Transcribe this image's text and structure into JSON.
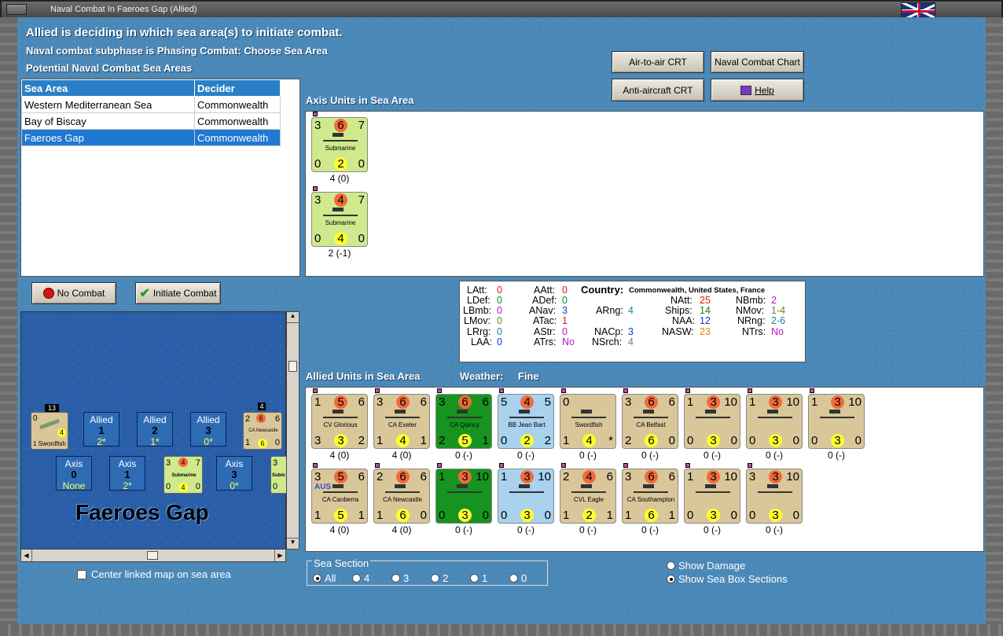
{
  "window": {
    "title": "Naval Combat In Faeroes Gap (Allied)"
  },
  "header": {
    "line1": "Allied is deciding in which sea area(s) to initiate combat.",
    "line2": "Naval combat subphase is Phasing Combat: Choose Sea Area",
    "line3": "Potential Naval Combat Sea Areas"
  },
  "buttons": {
    "air_to_air": "Air-to-air CRT",
    "naval_chart": "Naval Combat Chart",
    "anti_aircraft": "Anti-aircraft CRT",
    "help": "Help",
    "no_combat": "No Combat",
    "initiate_combat": "Initiate Combat"
  },
  "sea_table": {
    "headers": [
      "Sea Area",
      "Decider"
    ],
    "rows": [
      {
        "area": "Western Mediterranean Sea",
        "decider": "Commonwealth"
      },
      {
        "area": "Bay of Biscay",
        "decider": "Commonwealth"
      },
      {
        "area": "Faeroes Gap",
        "decider": "Commonwealth"
      }
    ]
  },
  "axis": {
    "label": "Axis Units in Sea Area",
    "units": [
      {
        "tl": "3",
        "tc": "6",
        "tr": "7",
        "name": "Submarine",
        "bl": "0",
        "bc": "2",
        "br": "0",
        "caption": "4 (0)"
      },
      {
        "tl": "3",
        "tc": "4",
        "tr": "7",
        "name": "Submarine",
        "bl": "0",
        "bc": "4",
        "br": "0",
        "caption": "2 (-1)"
      }
    ]
  },
  "stats": {
    "country_label": "Country:",
    "country": "Commonwealth, United States, France",
    "LAtt": "0",
    "LDef": "0",
    "LBmb": "0",
    "LMov": "0",
    "LRrg": "0",
    "LAA": "0",
    "AAtt": "0",
    "ADef": "0",
    "ANav": "3",
    "ATac": "1",
    "AStr": "0",
    "ATrs": "No",
    "ARng": "4",
    "NACp": "3",
    "NSrch": "4",
    "NAtt": "25",
    "Ships": "14",
    "NAA": "12",
    "NASW": "23",
    "NBmb": "2",
    "NMov": "1-4",
    "NRng": "2-6",
    "NTrs": "No"
  },
  "allied": {
    "label": "Allied Units in Sea Area",
    "weather_label": "Weather:",
    "weather": "Fine",
    "row1": [
      {
        "tl": "1",
        "tc": "5",
        "tr": "6",
        "name": "CV Glorious",
        "bl": "3",
        "bc": "3",
        "br": "2",
        "caption": "4 (0)",
        "style": "tan"
      },
      {
        "tl": "3",
        "tc": "6",
        "tr": "6",
        "name": "CA Exeter",
        "bl": "1",
        "bc": "4",
        "br": "1",
        "caption": "4 (0)",
        "style": "tan"
      },
      {
        "tl": "3",
        "tc": "6",
        "tr": "6",
        "name": "CA Quincy",
        "bl": "2",
        "bc": "5",
        "br": "1",
        "caption": "0 (-)",
        "style": "green"
      },
      {
        "tl": "5",
        "tc": "4",
        "tr": "5",
        "name": "BB Jean Bart",
        "bl": "0",
        "bc": "2",
        "br": "2",
        "caption": "0 (-)",
        "style": "blue"
      },
      {
        "tl": "0",
        "tc": "",
        "tr": "",
        "name": "Swordfish",
        "bl": "1",
        "bc": "4",
        "br": "*",
        "caption": "0 (-)",
        "style": "tan"
      },
      {
        "tl": "3",
        "tc": "6",
        "tr": "6",
        "name": "CA Belfast",
        "bl": "2",
        "bc": "6",
        "br": "0",
        "caption": "0 (-)",
        "style": "tan"
      },
      {
        "tl": "1",
        "tc": "3",
        "tr": "10",
        "name": "",
        "bl": "0",
        "bc": "3",
        "br": "0",
        "caption": "0 (-)",
        "style": "tan"
      },
      {
        "tl": "1",
        "tc": "3",
        "tr": "10",
        "name": "",
        "bl": "0",
        "bc": "3",
        "br": "0",
        "caption": "0 (-)",
        "style": "tan"
      },
      {
        "tl": "1",
        "tc": "3",
        "tr": "10",
        "name": "",
        "bl": "0",
        "bc": "3",
        "br": "0",
        "caption": "0 (-)",
        "style": "tan"
      }
    ],
    "row2": [
      {
        "tl": "3",
        "tc": "5",
        "tr": "6",
        "name": "CA Canberra",
        "bl": "1",
        "bc": "5",
        "br": "1",
        "caption": "4 (0)",
        "style": "tan"
      },
      {
        "tl": "2",
        "tc": "6",
        "tr": "6",
        "name": "CA Newcastle",
        "bl": "1",
        "bc": "6",
        "br": "0",
        "caption": "4 (0)",
        "style": "tan"
      },
      {
        "tl": "1",
        "tc": "3",
        "tr": "10",
        "name": "",
        "bl": "0",
        "bc": "3",
        "br": "0",
        "caption": "0 (-)",
        "style": "green"
      },
      {
        "tl": "1",
        "tc": "3",
        "tr": "10",
        "name": "",
        "bl": "0",
        "bc": "3",
        "br": "0",
        "caption": "0 (-)",
        "style": "blue"
      },
      {
        "tl": "2",
        "tc": "4",
        "tr": "6",
        "name": "CVL Eagle",
        "bl": "1",
        "bc": "2",
        "br": "1",
        "caption": "0 (-)",
        "style": "tan"
      },
      {
        "tl": "3",
        "tc": "6",
        "tr": "6",
        "name": "CA Southampton",
        "bl": "1",
        "bc": "6",
        "br": "1",
        "caption": "0 (-)",
        "style": "tan"
      },
      {
        "tl": "1",
        "tc": "3",
        "tr": "10",
        "name": "",
        "bl": "0",
        "bc": "3",
        "br": "0",
        "caption": "0 (-)",
        "style": "tan"
      },
      {
        "tl": "3",
        "tc": "3",
        "tr": "10",
        "name": "",
        "bl": "0",
        "bc": "3",
        "br": "0",
        "caption": "0 (-)",
        "style": "tan"
      }
    ],
    "aus_tag": "AUS"
  },
  "seabox": {
    "title": "Faeroes Gap",
    "allied_slots": [
      {
        "side": "Allied",
        "num": "1",
        "val": "2*"
      },
      {
        "side": "Allied",
        "num": "2",
        "val": "1*"
      },
      {
        "side": "Allied",
        "num": "3",
        "val": "0*"
      }
    ],
    "axis_slots": [
      {
        "side": "Axis",
        "num": "0",
        "val": "None"
      },
      {
        "side": "Axis",
        "num": "1",
        "val": "2*"
      },
      {
        "side": "Axis",
        "num": "3",
        "val": "0*"
      }
    ],
    "stack_a": "13",
    "stack_b": "4",
    "swordfish": "1 Swordfish",
    "newcastle": "CA Newcastle",
    "submarine": "Submarine",
    "sub_short": "Subm"
  },
  "options": {
    "center_linked": "Center linked map on sea area",
    "sea_section": "Sea Section",
    "sections": [
      "All",
      "4",
      "3",
      "2",
      "1",
      "0"
    ],
    "show_damage": "Show Damage",
    "show_boxes": "Show Sea Box Sections"
  },
  "colors": {
    "accent": "#1f78d2",
    "ocean": "#4a88b8"
  }
}
